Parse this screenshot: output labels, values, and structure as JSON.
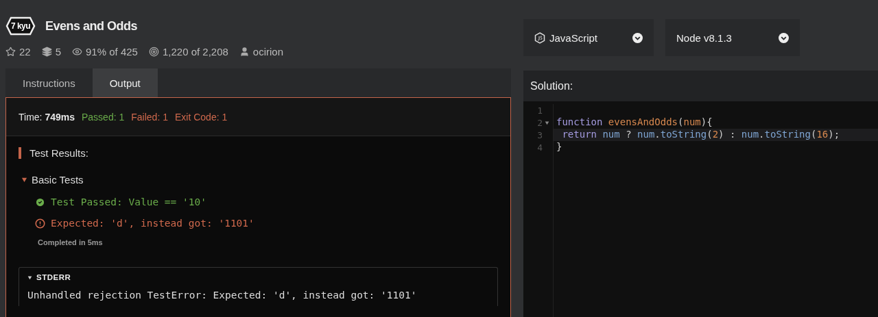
{
  "kata": {
    "rank": "7 kyu",
    "title": "Evens and Odds",
    "stats": [
      {
        "kind": "star",
        "text": "22"
      },
      {
        "kind": "collections",
        "text": "5"
      },
      {
        "kind": "satisfaction",
        "text": "91% of 425"
      },
      {
        "kind": "completed",
        "text": "1,220 of 2,208"
      },
      {
        "kind": "author",
        "text": "ocirion"
      }
    ]
  },
  "selectors": [
    {
      "kind": "language",
      "label": "JavaScript"
    },
    {
      "kind": "version",
      "label": "Node v8.1.3"
    }
  ],
  "tabs": [
    {
      "label": "Instructions",
      "selected": false
    },
    {
      "label": "Output",
      "selected": true
    }
  ],
  "output": {
    "summary": [
      {
        "kind": "time",
        "label": "Time:",
        "value": "749ms"
      },
      {
        "kind": "passed",
        "label": "Passed:",
        "value": "1"
      },
      {
        "kind": "failed",
        "label": "Failed:",
        "value": "1"
      },
      {
        "kind": "exit",
        "label": "Exit Code:",
        "value": "1"
      }
    ],
    "results_title": "Test Results:",
    "group": {
      "title": "Basic Tests",
      "expanded": true,
      "results": [
        {
          "kind": "pass",
          "text": "Test Passed: Value == '10'"
        },
        {
          "kind": "fail",
          "text": "Expected: 'd', instead got: '1101'"
        }
      ],
      "completed": "Completed in 5ms"
    },
    "stderr": {
      "title": "STDERR",
      "expanded": true,
      "text": "Unhandled rejection TestError: Expected: 'd', instead got: '1101'"
    }
  },
  "solution": {
    "title": "Solution:",
    "lines": [
      {
        "number": "1",
        "foldable": false,
        "active": false
      },
      {
        "number": "2",
        "foldable": true,
        "active": false,
        "tokens": [
          {
            "text": "function ",
            "kind": "keyword"
          },
          {
            "text": "evensAndOdds",
            "kind": "name"
          },
          {
            "text": "(",
            "kind": "plain"
          },
          {
            "text": "num",
            "kind": "param"
          },
          {
            "text": "){",
            "kind": "plain"
          }
        ]
      },
      {
        "number": "3",
        "foldable": false,
        "active": true,
        "tokens": [
          {
            "text": " return ",
            "kind": "keyword"
          },
          {
            "text": "num",
            "kind": "variable"
          },
          {
            "text": " ? ",
            "kind": "plain"
          },
          {
            "text": "num",
            "kind": "variable"
          },
          {
            "text": ".",
            "kind": "plain"
          },
          {
            "text": "toString",
            "kind": "variable"
          },
          {
            "text": "(",
            "kind": "plain"
          },
          {
            "text": "2",
            "kind": "number"
          },
          {
            "text": ") : ",
            "kind": "plain"
          },
          {
            "text": "num",
            "kind": "variable"
          },
          {
            "text": ".",
            "kind": "plain"
          },
          {
            "text": "toString",
            "kind": "variable"
          },
          {
            "text": "(",
            "kind": "plain"
          },
          {
            "text": "16",
            "kind": "number"
          },
          {
            "text": ");",
            "kind": "plain"
          }
        ]
      },
      {
        "number": "4",
        "foldable": false,
        "active": false,
        "tokens": [
          {
            "text": "}",
            "kind": "plain"
          }
        ]
      }
    ]
  }
}
